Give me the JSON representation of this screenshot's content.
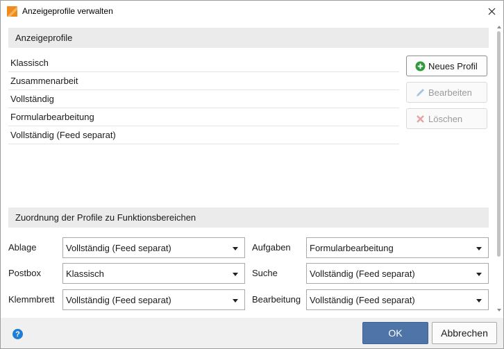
{
  "window": {
    "title": "Anzeigeprofile verwalten",
    "icon": "app-icon-orange"
  },
  "profiles_section": {
    "header": "Anzeigeprofile",
    "items": [
      {
        "label": "Klassisch"
      },
      {
        "label": "Zusammenarbeit"
      },
      {
        "label": "Vollständig"
      },
      {
        "label": "Formularbearbeitung"
      },
      {
        "label": "Vollständig (Feed separat)"
      }
    ],
    "buttons": {
      "new": {
        "label": "Neues Profil",
        "icon": "plus-circle-icon",
        "enabled": true,
        "icon_color": "#2e9a3c"
      },
      "edit": {
        "label": "Bearbeiten",
        "icon": "pencil-icon",
        "enabled": false
      },
      "delete": {
        "label": "Löschen",
        "icon": "x-icon",
        "enabled": false
      }
    }
  },
  "assignment_section": {
    "header": "Zuordnung der Profile zu Funktionsbereichen",
    "rows": [
      {
        "left_label": "Ablage",
        "left_value": "Vollständig (Feed separat)",
        "right_label": "Aufgaben",
        "right_value": "Formularbearbeitung"
      },
      {
        "left_label": "Postbox",
        "left_value": "Klassisch",
        "right_label": "Suche",
        "right_value": "Vollständig (Feed separat)"
      },
      {
        "left_label": "Klemmbrett",
        "left_value": "Vollständig (Feed separat)",
        "right_label": "Bearbeitung",
        "right_value": "Vollständig (Feed separat)"
      }
    ]
  },
  "footer": {
    "help_icon": "help-icon",
    "help_symbol": "?",
    "ok_label": "OK",
    "cancel_label": "Abbrechen"
  },
  "colors": {
    "accent": "#4e74a8",
    "section_header_bg": "#ebebeb",
    "footer_bg": "#f0f0f0",
    "app_icon": "#f08a1c"
  }
}
